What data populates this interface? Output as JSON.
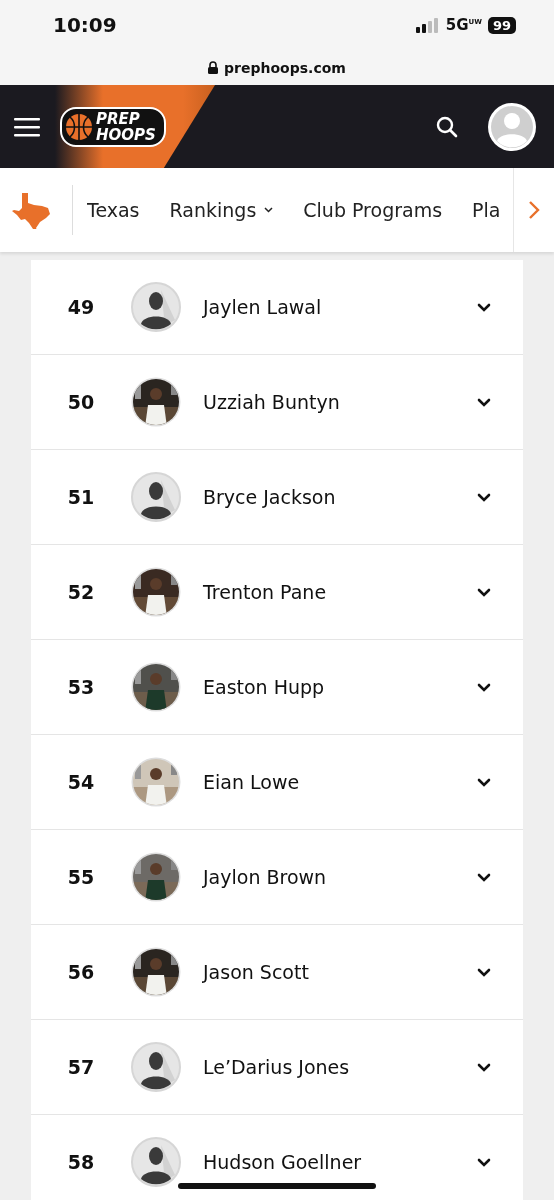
{
  "status_bar": {
    "time": "10:09",
    "network": "5G",
    "network_sub": "UW",
    "battery": "99"
  },
  "browser": {
    "url": "prephoops.com"
  },
  "header": {
    "logo_top": "PREP",
    "logo_bottom": "HOOPS"
  },
  "nav": {
    "items": [
      {
        "label": "Texas",
        "dropdown": false
      },
      {
        "label": "Rankings",
        "dropdown": true
      },
      {
        "label": "Club Programs",
        "dropdown": false
      },
      {
        "label": "Pla",
        "dropdown": false
      }
    ]
  },
  "players": [
    {
      "rank": "49",
      "name": "Jaylen Lawal",
      "kind": "silhouette"
    },
    {
      "rank": "50",
      "name": "Uzziah Buntyn",
      "kind": "picture"
    },
    {
      "rank": "51",
      "name": "Bryce Jackson",
      "kind": "silhouette"
    },
    {
      "rank": "52",
      "name": "Trenton Pane",
      "kind": "picture"
    },
    {
      "rank": "53",
      "name": "Easton Hupp",
      "kind": "picture"
    },
    {
      "rank": "54",
      "name": "Eian Lowe",
      "kind": "picture"
    },
    {
      "rank": "55",
      "name": "Jaylon Brown",
      "kind": "picture"
    },
    {
      "rank": "56",
      "name": "Jason Scott",
      "kind": "picture"
    },
    {
      "rank": "57",
      "name": "Le’Darius Jones",
      "kind": "silhouette"
    },
    {
      "rank": "58",
      "name": "Hudson Goellner",
      "kind": "silhouette"
    }
  ]
}
